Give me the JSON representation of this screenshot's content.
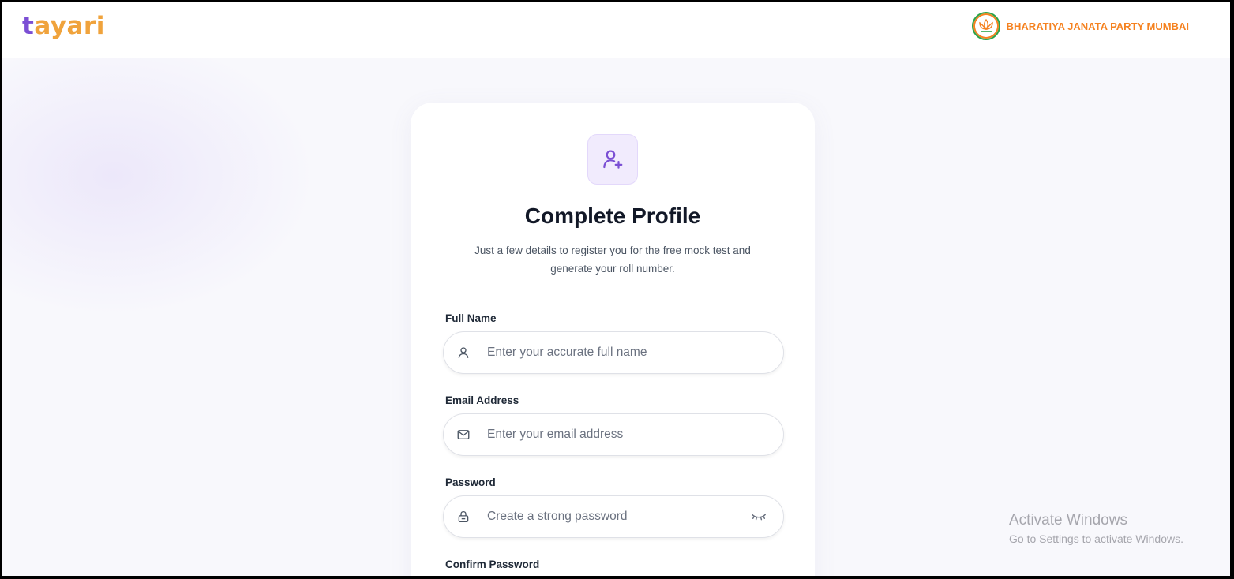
{
  "header": {
    "logo_first": "t",
    "logo_rest": "ayari",
    "partner_name": "BHARATIYA JANATA PARTY MUMBAI",
    "partner_icon": "lotus-emblem-icon"
  },
  "form": {
    "icon": "user-plus-icon",
    "title": "Complete Profile",
    "subtitle": "Just a few details to register you for the free mock test and generate your roll number.",
    "fields": [
      {
        "label": "Full Name",
        "placeholder": "Enter your accurate full name",
        "icon": "user-icon"
      },
      {
        "label": "Email Address",
        "placeholder": "Enter your email address",
        "icon": "mail-icon"
      },
      {
        "label": "Password",
        "placeholder": "Create a strong password",
        "icon": "lock-icon",
        "toggle_icon": "eye-closed-icon"
      },
      {
        "label": "Confirm Password"
      }
    ]
  },
  "watermark": {
    "title": "Activate Windows",
    "subtitle": "Go to Settings to activate Windows."
  },
  "colors": {
    "brand_purple": "#7b4fd4",
    "brand_orange": "#f0a33c",
    "partner_orange": "#f58220",
    "partner_green": "#2ba34a",
    "title_text": "#121827"
  }
}
